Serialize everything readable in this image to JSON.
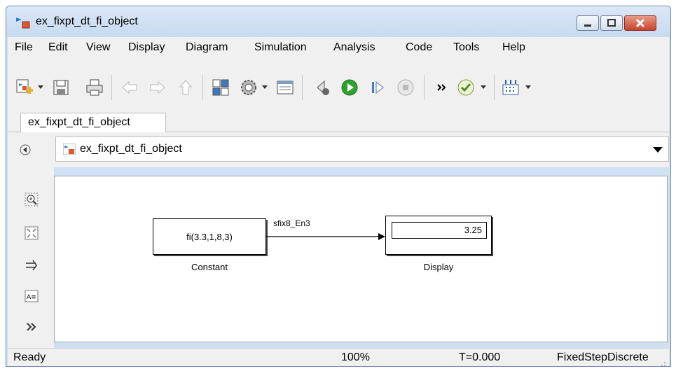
{
  "window": {
    "title": "ex_fixpt_dt_fi_object"
  },
  "menu": [
    "File",
    "Edit",
    "View",
    "Display",
    "Diagram",
    "Simulation",
    "Analysis",
    "Code",
    "Tools",
    "Help"
  ],
  "tab": {
    "label": "ex_fixpt_dt_fi_object"
  },
  "address": {
    "path": "ex_fixpt_dt_fi_object"
  },
  "model": {
    "constant": {
      "text": "fi(3.3,1,8,3)",
      "name": "Constant"
    },
    "display": {
      "value": "3.25",
      "name": "Display"
    },
    "signal_label": "sfix8_En3"
  },
  "status": {
    "state": "Ready",
    "zoom": "100%",
    "time": "T=0.000",
    "solver": "FixedStepDiscrete"
  },
  "icons": {
    "toolbar": [
      "new-model-icon",
      "save-icon",
      "print-icon",
      "back-arrow-icon",
      "forward-arrow-icon",
      "up-arrow-icon",
      "library-browser-icon",
      "model-config-icon",
      "model-explorer-icon",
      "step-back-icon",
      "run-icon",
      "step-forward-icon",
      "stop-icon",
      "more-icon",
      "check-icon",
      "build-icon"
    ],
    "palette": [
      "zoom-icon",
      "fit-view-icon",
      "arrow-icon",
      "annotation-icon",
      "expand-icon"
    ]
  },
  "colors": {
    "run": "#2fa12f",
    "title_bg": "#cfe0f3",
    "close_button": "#c7432b"
  }
}
